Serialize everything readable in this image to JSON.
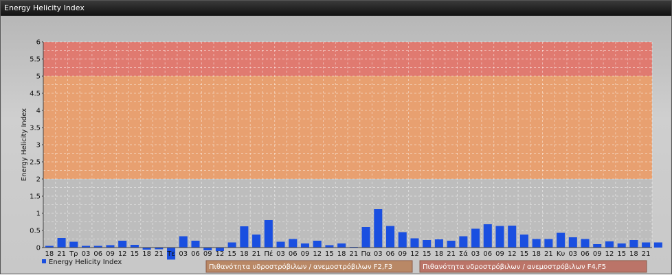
{
  "window": {
    "title": "Energy Helicity Index"
  },
  "chart_data": {
    "type": "bar",
    "ylabel": "Energy Helicity Index",
    "ylim": [
      -0.3,
      6
    ],
    "yticks": [
      "0",
      "0.5",
      "1",
      "1.5",
      "2",
      "2.5",
      "3",
      "3.5",
      "4",
      "4.5",
      "5",
      "5.5",
      "6"
    ],
    "grid": true,
    "categories": [
      "18",
      "21",
      "Τρ",
      "03",
      "06",
      "09",
      "12",
      "15",
      "18",
      "21",
      "Τε",
      "03",
      "06",
      "09",
      "12",
      "15",
      "18",
      "21",
      "Πέ",
      "03",
      "06",
      "09",
      "12",
      "15",
      "18",
      "21",
      "Πα",
      "03",
      "06",
      "09",
      "12",
      "15",
      "18",
      "21",
      "Σά",
      "03",
      "06",
      "09",
      "12",
      "15",
      "18",
      "21",
      "Κυ",
      "03",
      "06",
      "09",
      "12",
      "15",
      "18",
      "21"
    ],
    "series": [
      {
        "name": "Energy Helicity Index",
        "color": "#1a4fe0",
        "values": [
          0.05,
          0.28,
          0.17,
          0.05,
          0.05,
          0.07,
          0.2,
          0.08,
          -0.06,
          -0.05,
          -0.35,
          0.33,
          0.2,
          -0.08,
          -0.1,
          0.15,
          0.62,
          0.38,
          0.8,
          0.17,
          0.25,
          0.12,
          0.2,
          0.07,
          0.12,
          0.02,
          0.6,
          1.12,
          0.63,
          0.45,
          0.27,
          0.22,
          0.24,
          0.2,
          0.33,
          0.55,
          0.68,
          0.63,
          0.64,
          0.38,
          0.25,
          0.25,
          0.43,
          0.3,
          0.25,
          0.1,
          0.18,
          0.12,
          0.22,
          0.15,
          0.15
        ]
      }
    ],
    "bands": [
      {
        "from": 2,
        "to": 5,
        "color": "#e8a070",
        "label": "Πιθανότητα υδροστρόβιλων / ανεμοστρόβιλων F2,F3"
      },
      {
        "from": 5,
        "to": 6,
        "color": "#e07a70",
        "label": "Πιθανότητα υδροστρόβιλων / ανεμοστρόβιλων F4,F5"
      }
    ],
    "legend": {
      "position": "bottom-left",
      "label": "Energy Helicity Index"
    }
  }
}
